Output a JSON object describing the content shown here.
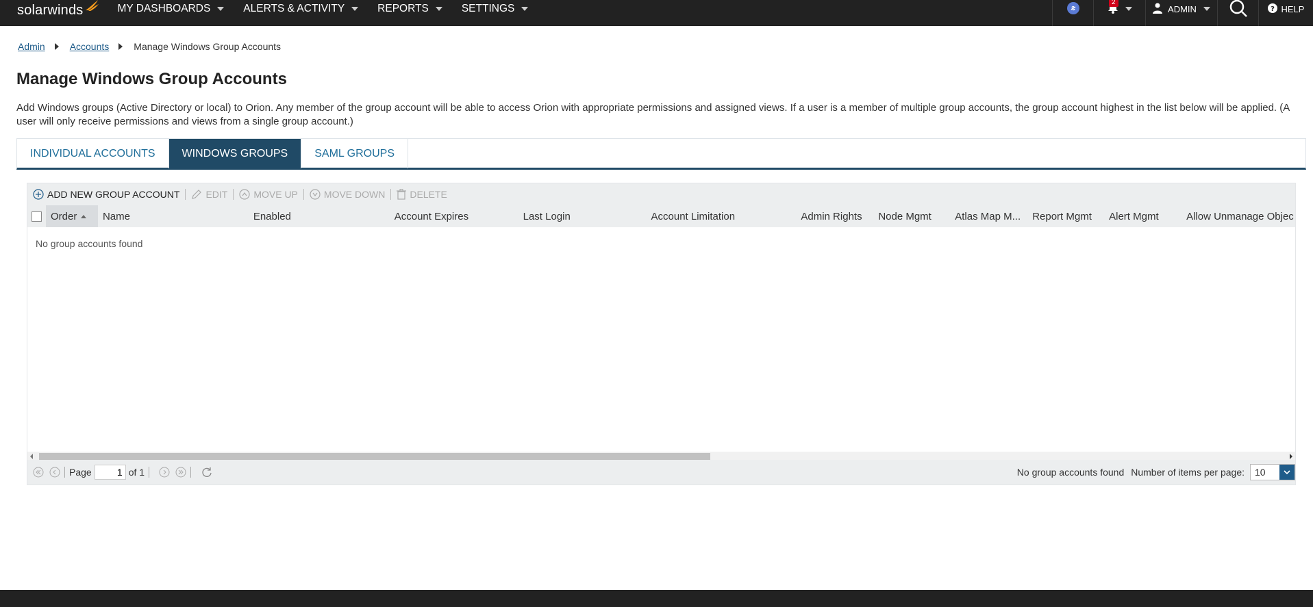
{
  "nav": {
    "logo_text": "solarwinds",
    "items": [
      {
        "label": "MY DASHBOARDS"
      },
      {
        "label": "ALERTS & ACTIVITY"
      },
      {
        "label": "REPORTS"
      },
      {
        "label": "SETTINGS"
      }
    ],
    "notification_count": "2",
    "user_label": "ADMIN",
    "help_label": "HELP"
  },
  "breadcrumb": {
    "items": [
      "Admin",
      "Accounts"
    ],
    "current": "Manage Windows Group Accounts"
  },
  "page": {
    "title": "Manage Windows Group Accounts",
    "description": "Add Windows groups (Active Directory or local) to Orion. Any member of the group account will be able to access Orion with appropriate permissions and assigned views. If a user is a member of multiple group accounts, the group account highest in the list below will be applied. (A user will only receive permissions and views from a single group account.)"
  },
  "tabs": [
    {
      "label": "INDIVIDUAL ACCOUNTS",
      "active": false
    },
    {
      "label": "WINDOWS GROUPS",
      "active": true
    },
    {
      "label": "SAML GROUPS",
      "active": false
    }
  ],
  "toolbar": {
    "add_label": "ADD NEW GROUP ACCOUNT",
    "edit_label": "EDIT",
    "move_up_label": "MOVE UP",
    "move_down_label": "MOVE DOWN",
    "delete_label": "DELETE"
  },
  "table": {
    "columns": [
      "Order",
      "Name",
      "Enabled",
      "Account Expires",
      "Last Login",
      "Account Limitation",
      "Admin Rights",
      "Node Mgmt",
      "Atlas Map M...",
      "Report Mgmt",
      "Alert Mgmt",
      "Allow Unmanage Objec"
    ],
    "sorted_column": "Order",
    "empty_message": "No group accounts found"
  },
  "pager": {
    "page_label": "Page",
    "page_value": "1",
    "of_label": "of 1",
    "status": "No group accounts found",
    "items_per_page_label": "Number of items per page:",
    "items_per_page_value": "10"
  },
  "colors": {
    "topbar": "#222222",
    "tab_active": "#204a66",
    "link": "#1f5c8a",
    "accent_orange": "#f99d1c"
  }
}
